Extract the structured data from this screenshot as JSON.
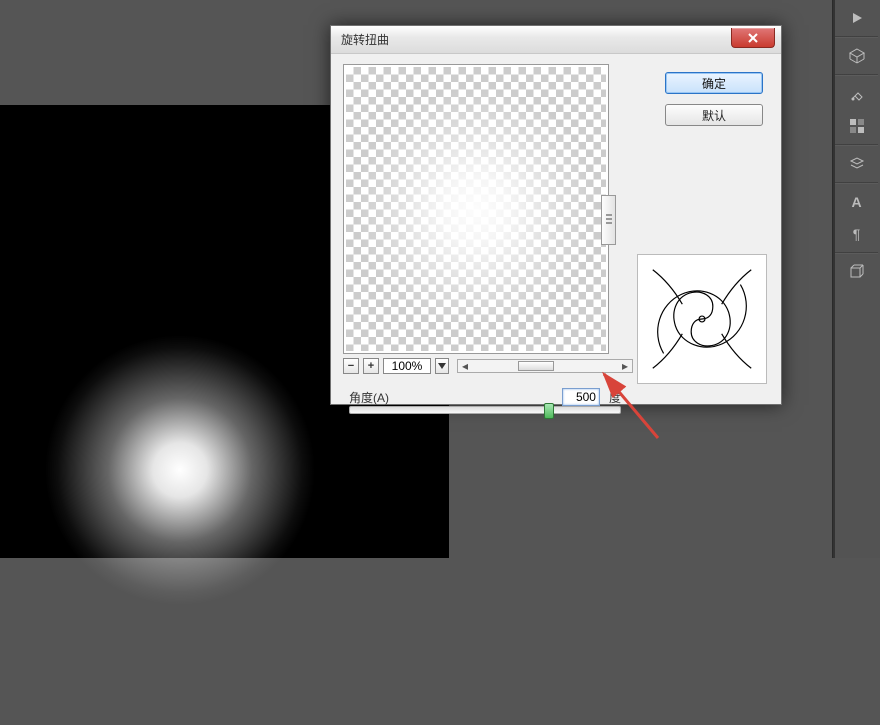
{
  "dialog": {
    "title": "旋转扭曲",
    "ok_label": "确定",
    "cancel_label": "默认",
    "zoom": {
      "minus": "−",
      "plus": "+",
      "value": "100%"
    },
    "angle": {
      "label": "角度(A)",
      "value": "500",
      "unit": "度"
    }
  },
  "right_panel": {
    "icons": [
      {
        "name": "play-icon"
      },
      {
        "name": "cube-icon"
      },
      {
        "name": "brush-icon"
      },
      {
        "name": "swatches-icon"
      },
      {
        "name": "layers-icon"
      },
      {
        "name": "character-icon",
        "glyph": "A"
      },
      {
        "name": "paragraph-icon",
        "glyph": "¶"
      },
      {
        "name": "box3d-icon"
      }
    ]
  },
  "annotation": {
    "arrow_color": "#d8443a"
  }
}
